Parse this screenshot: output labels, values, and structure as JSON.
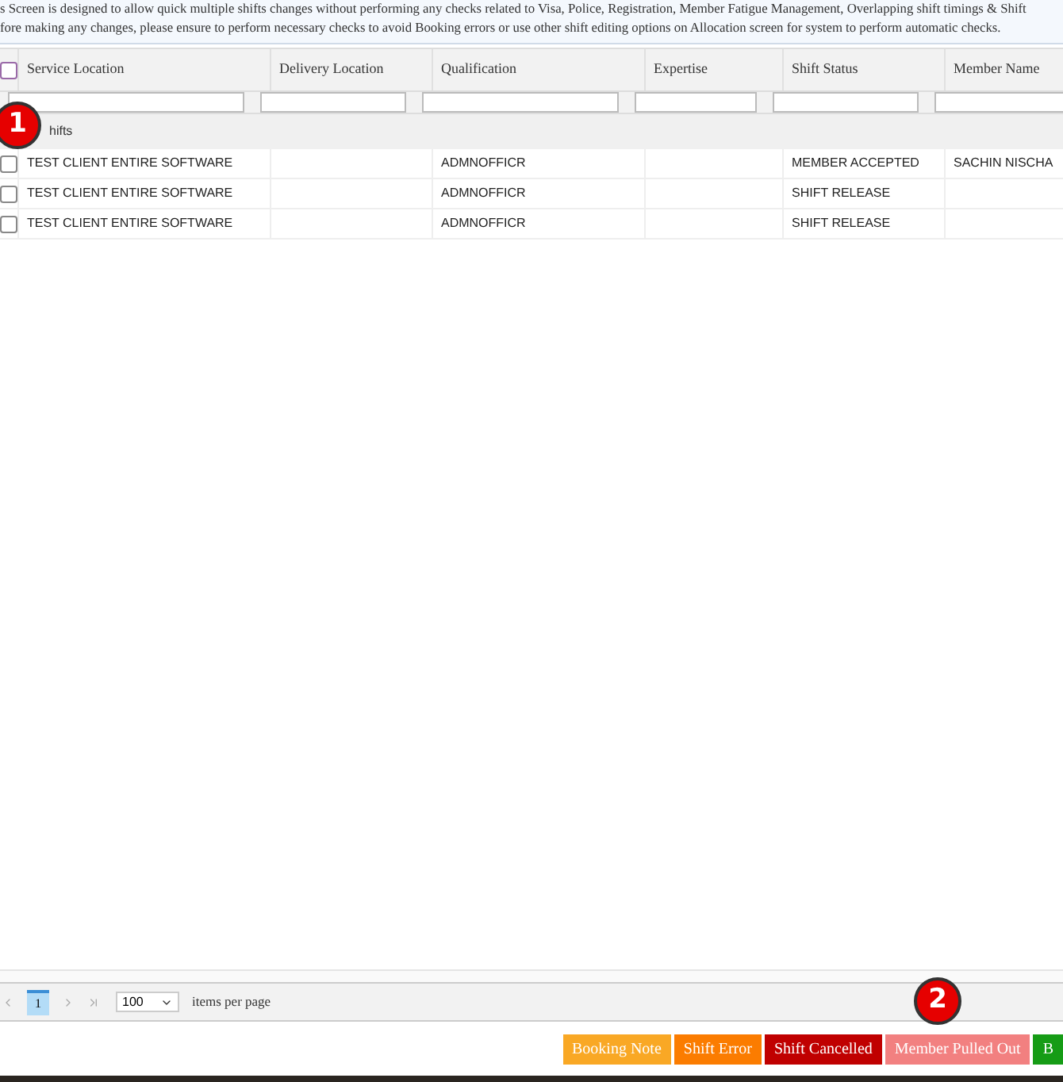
{
  "notice": {
    "lines": [
      "s Screen is designed to allow quick multiple shifts changes without performing any checks related to Visa, Police, Registration, Member Fatigue Management, Overlapping shift timings & Shift",
      "fore making any changes, please ensure to perform necessary checks to avoid Booking errors or use other shift editing options on Allocation screen for system to perform automatic checks."
    ]
  },
  "table": {
    "select_all": {
      "checked": false
    },
    "columns": [
      "Service Location",
      "Delivery Location",
      "Qualification",
      "Expertise",
      "Shift Status",
      "Member Name"
    ],
    "group": "hifts",
    "rows": [
      {
        "checked": false,
        "cells": [
          "TEST CLIENT ENTIRE SOFTWARE",
          "",
          "ADMNOFFICR",
          "",
          "MEMBER ACCEPTED",
          "SACHIN NISCHA"
        ]
      },
      {
        "checked": false,
        "cells": [
          "TEST CLIENT ENTIRE SOFTWARE",
          "",
          "ADMNOFFICR",
          "",
          "SHIFT RELEASE",
          ""
        ]
      },
      {
        "checked": false,
        "cells": [
          "TEST CLIENT ENTIRE SOFTWARE",
          "",
          "ADMNOFFICR",
          "",
          "SHIFT RELEASE",
          ""
        ]
      }
    ]
  },
  "pager": {
    "pages": [
      {
        "label": "1",
        "selected": true
      }
    ],
    "page_size": "100",
    "page_size_label": "items per page"
  },
  "markers": [
    "1",
    "2"
  ],
  "buttons": [
    {
      "label": "Booking Note",
      "color": "#f9a825"
    },
    {
      "label": "Shift Error",
      "color": "#fb7c00"
    },
    {
      "label": "Shift Cancelled",
      "color": "#c00000"
    },
    {
      "label": "Member Pulled Out",
      "color": "#f28080"
    },
    {
      "label": "B",
      "color": "#169c16"
    }
  ]
}
